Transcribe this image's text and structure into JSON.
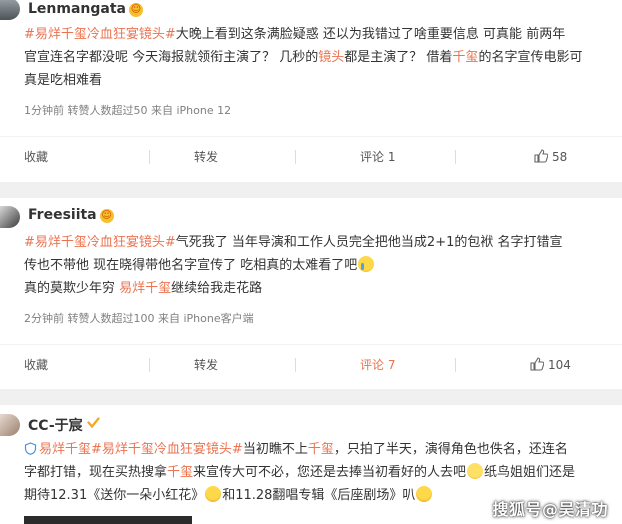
{
  "posts": [
    {
      "name": "Lenmangata",
      "lines": [
        [
          {
            "t": "#易烊千玺冷血狂宴镜头#",
            "c": "tag"
          },
          {
            "t": "大晚上看到这条满脸疑惑 还以为我错过了啥重要信息 可真能 前两年",
            "c": ""
          }
        ],
        [
          {
            "t": "官宣连名字都没呢 今天海报就领衔主演了？ 几秒的",
            "c": ""
          },
          {
            "t": "镜头",
            "c": "hl"
          },
          {
            "t": "都是主演了？ 借着",
            "c": ""
          },
          {
            "t": "千玺",
            "c": "hl"
          },
          {
            "t": "的名字宣传电影可",
            "c": ""
          }
        ],
        [
          {
            "t": "真是吃相难看",
            "c": ""
          }
        ]
      ],
      "meta": "1分钟前 转赞人数超过50   来自 iPhone 12",
      "actions": {
        "collect": "收藏",
        "forward": "转发",
        "comment": "评论 1",
        "like": "58"
      }
    },
    {
      "name": "Freesiita",
      "lines": [
        [
          {
            "t": "#易烊千玺冷血狂宴镜头#",
            "c": "tag"
          },
          {
            "t": "气死我了 当年导演和工作人员完全把他当成2+1的包袱 名字打错宣",
            "c": ""
          }
        ],
        [
          {
            "t": "传也不带他 现在晓得带他名字宣传了 吃相真的太难看了吧",
            "c": ""
          },
          {
            "e": "cry"
          }
        ],
        [
          {
            "t": "真的莫欺少年穷 ",
            "c": ""
          },
          {
            "t": "易烊千玺",
            "c": "hl"
          },
          {
            "t": "继续给我走花路",
            "c": ""
          }
        ]
      ],
      "meta": "2分钟前 转赞人数超过100   来自 iPhone客户端",
      "actions": {
        "collect": "收藏",
        "forward": "转发",
        "comment": "评论 7",
        "like": "104"
      }
    },
    {
      "name": "CC-于宸",
      "lines": [
        [
          {
            "e": "shield"
          },
          {
            "t": "易烊千玺",
            "c": "hl"
          },
          {
            "t": "#易烊千玺冷血狂宴镜头#",
            "c": "tag"
          },
          {
            "t": "当初瞧不上",
            "c": ""
          },
          {
            "t": "千玺",
            "c": "hl"
          },
          {
            "t": "，只拍了半天，演得角色也佚名，还连名",
            "c": ""
          }
        ],
        [
          {
            "t": "字都打错，现在买热搜拿",
            "c": ""
          },
          {
            "t": "千玺",
            "c": "hl"
          },
          {
            "t": "来宣传大可不必，您还是去捧当初看好的人去吧",
            "c": ""
          },
          {
            "e": "smile"
          },
          {
            "t": "纸鸟姐姐们还是",
            "c": ""
          }
        ],
        [
          {
            "t": "期待12.31《送你一朵小红花》",
            "c": ""
          },
          {
            "e": "scream"
          },
          {
            "t": "和11.28翻唱专辑《后座剧场》叭",
            "c": ""
          },
          {
            "e": "scream"
          }
        ]
      ]
    }
  ],
  "watermark": "搜狐号@吴清功",
  "colors": {
    "accent": "#eb7350",
    "meta": "#808080",
    "divider": "#f0f0f0",
    "badge": "#f5c02c",
    "verified": "#f5a623"
  }
}
